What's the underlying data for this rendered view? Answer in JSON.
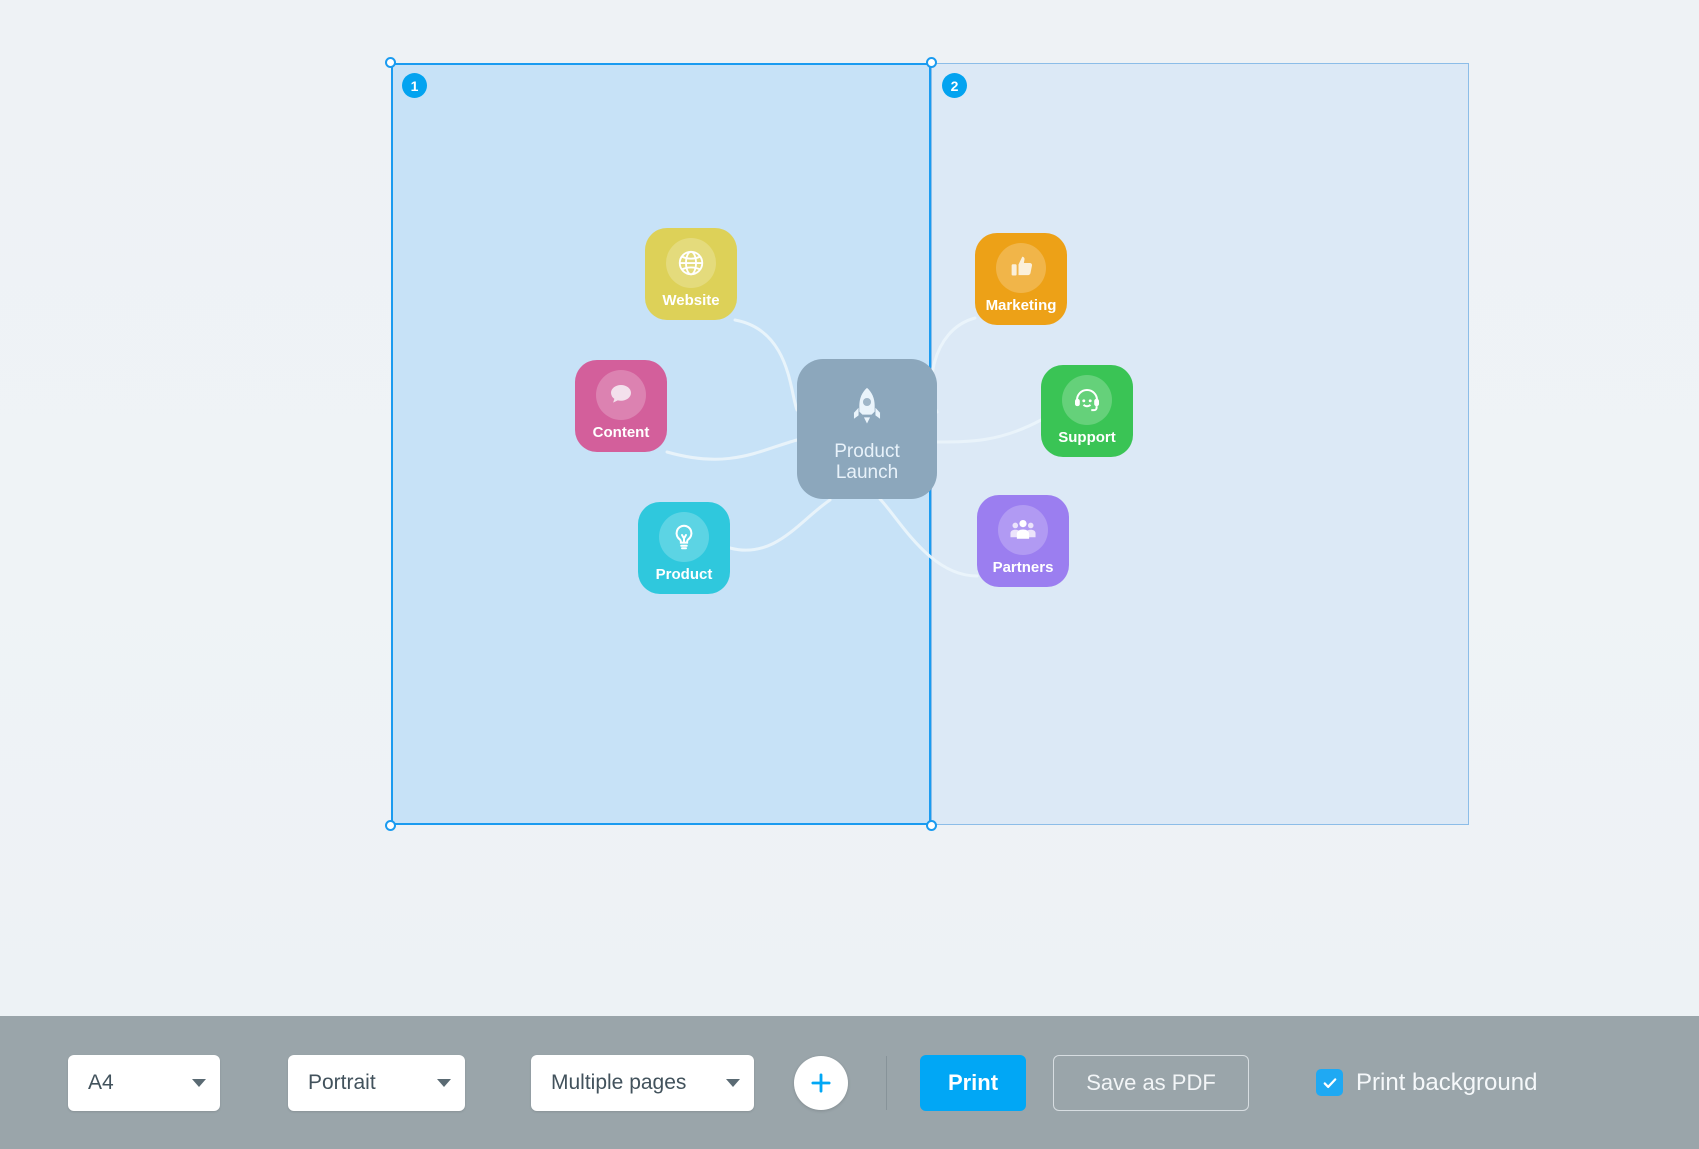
{
  "canvas": {
    "pages": [
      {
        "number": "1",
        "selected": true
      },
      {
        "number": "2",
        "selected": false
      }
    ]
  },
  "mindmap": {
    "center": {
      "label": "Product\nLaunch",
      "label_line1": "Product",
      "label_line2": "Launch",
      "icon": "rocket-icon",
      "color": "#8ca7bc"
    },
    "branches": [
      {
        "id": "website",
        "label": "Website",
        "icon": "globe-icon",
        "color": "#ddd158"
      },
      {
        "id": "content",
        "label": "Content",
        "icon": "chat-bubble-icon",
        "color": "#d35f9b"
      },
      {
        "id": "product",
        "label": "Product",
        "icon": "lightbulb-icon",
        "color": "#2fc8dd"
      },
      {
        "id": "marketing",
        "label": "Marketing",
        "icon": "thumbs-up-icon",
        "color": "#eda117"
      },
      {
        "id": "support",
        "label": "Support",
        "icon": "headset-icon",
        "color": "#3ac455"
      },
      {
        "id": "partners",
        "label": "Partners",
        "icon": "people-group-icon",
        "color": "#9b7ef0"
      }
    ]
  },
  "toolbar": {
    "paper_size": "A4",
    "orientation": "Portrait",
    "page_mode": "Multiple pages",
    "add_page_icon": "plus-icon",
    "print_label": "Print",
    "save_pdf_label": "Save as PDF",
    "print_background_label": "Print background",
    "print_background_checked": true,
    "accent_color": "#01a7f5",
    "bar_color": "#9aa5aa"
  }
}
